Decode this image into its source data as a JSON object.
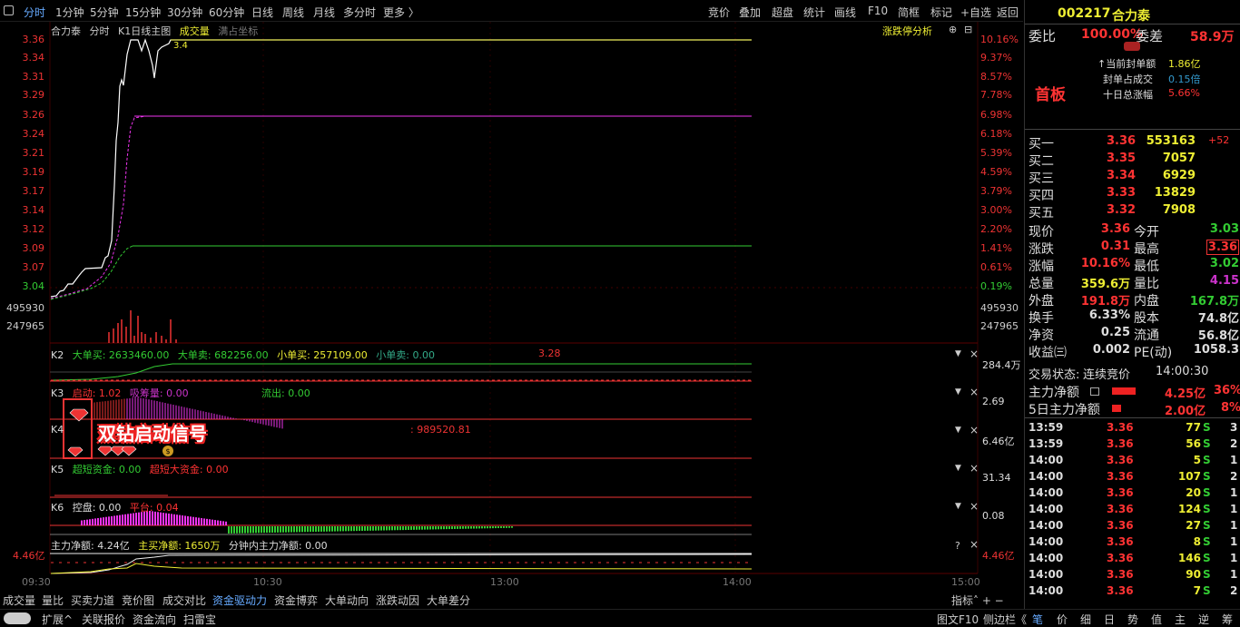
{
  "toolbar": {
    "tabs": [
      "分时",
      "1分钟",
      "5分钟",
      "15分钟",
      "30分钟",
      "60分钟",
      "日线",
      "周线",
      "月线",
      "多分时",
      "更多 〉"
    ],
    "right": [
      "竞价",
      "叠加",
      "超盘",
      "统计",
      "画线",
      "F10",
      "简框",
      "标记",
      "+自选",
      "返回"
    ]
  },
  "chart": {
    "tabs": [
      "合力泰",
      "分时",
      "K1日线主图",
      "成交量",
      "满占坐标"
    ],
    "right_btn": "涨跌停分析",
    "price_label": "3.4",
    "left_axis": [
      "3.36",
      "3.34",
      "3.31",
      "3.29",
      "3.26",
      "3.24",
      "3.21",
      "3.19",
      "3.17",
      "3.14",
      "3.12",
      "3.09",
      "3.07",
      "3.04"
    ],
    "right_axis": [
      "10.16%",
      "9.37%",
      "8.57%",
      "7.78%",
      "6.98%",
      "6.18%",
      "5.39%",
      "4.59%",
      "3.79%",
      "3.00%",
      "2.20%",
      "1.41%",
      "0.61%",
      "0.19%"
    ],
    "vol_axis": [
      "495930",
      "247965"
    ],
    "vol_axis_r": [
      "495930",
      "247965"
    ]
  },
  "k2": {
    "label": "K2",
    "items": [
      {
        "t": "大单买: 2633460.00",
        "c": "g"
      },
      {
        "t": "大单卖: 682256.00",
        "c": "g"
      },
      {
        "t": "小单买: 257109.00",
        "c": "y"
      },
      {
        "t": "小单卖: 0.00",
        "c": "c"
      }
    ],
    "extra": "3.28",
    "rv": "284.4万"
  },
  "k3": {
    "label": "K3",
    "items": [
      {
        "t": "启动: 1.02",
        "c": "r"
      },
      {
        "t": "吸筹量: 0.00",
        "c": "m"
      }
    ],
    "extra": "流出: 0.00",
    "rv": "2.69"
  },
  "k4": {
    "label": "K4",
    "extra": ": 989520.81",
    "rv": "6.46亿",
    "signal": "双钻启动信号"
  },
  "k5": {
    "label": "K5",
    "items": [
      {
        "t": "超短资金: 0.00",
        "c": "g"
      },
      {
        "t": "超短大资金: 0.00",
        "c": "r"
      }
    ],
    "rv": "31.34"
  },
  "k6": {
    "label": "K6",
    "items": [
      {
        "t": "控盘: 0.00",
        "c": "w"
      },
      {
        "t": "平台: 0.04",
        "c": "r"
      }
    ],
    "rv": "0.08"
  },
  "k7": {
    "items": [
      {
        "t": "主力净额: 4.24亿",
        "c": "w"
      },
      {
        "t": "主买净额: 1650万",
        "c": "y"
      },
      {
        "t": "分钟内主力净额: 0.00",
        "c": "w"
      }
    ],
    "lv": "4.46亿",
    "rv": "4.46亿",
    "q": "?"
  },
  "time_axis": [
    "09:30",
    "10:30",
    "13:00",
    "14:00",
    "15:00"
  ],
  "bottom_tabs": [
    "成交量",
    "量比",
    "买卖力道",
    "竞价图",
    "成交对比",
    "资金驱动力",
    "资金博弈",
    "大单动向",
    "涨跌动因",
    "大单差分"
  ],
  "bottom_right": "指标˄  +  −",
  "status_bar": [
    "扩展^",
    "关联报价",
    "资金流向",
    "扫雷宝"
  ],
  "status_right": [
    "图文F10",
    "侧边栏《",
    "笔",
    "价",
    "细",
    "日",
    "势",
    "值",
    "主",
    "逆",
    "筹"
  ],
  "quote": {
    "code": "002217",
    "name": "合力泰",
    "wb_label": "委比",
    "wb": "100.00%",
    "wc_label": "委差",
    "wc": "58.9万",
    "info": [
      {
        "l": "↑当前封单额",
        "v": "1.86亿"
      },
      {
        "l": "封单占成交",
        "v": "0.15倍"
      },
      {
        "l": "十日总涨幅",
        "v": "5.66%"
      }
    ],
    "board": "首板",
    "bids": [
      {
        "l": "买一",
        "p": "3.36",
        "v": "553163",
        "x": "+52"
      },
      {
        "l": "买二",
        "p": "3.35",
        "v": "7057",
        "x": ""
      },
      {
        "l": "买三",
        "p": "3.34",
        "v": "6929",
        "x": ""
      },
      {
        "l": "买四",
        "p": "3.33",
        "v": "13829",
        "x": ""
      },
      {
        "l": "买五",
        "p": "3.32",
        "v": "7908",
        "x": ""
      }
    ],
    "stats": [
      {
        "l1": "现价",
        "v1": "3.36",
        "c1": "r",
        "l2": "今开",
        "v2": "3.03",
        "c2": "g"
      },
      {
        "l1": "涨跌",
        "v1": "0.31",
        "c1": "r",
        "l2": "最高",
        "v2": "3.36",
        "c2": "r"
      },
      {
        "l1": "涨幅",
        "v1": "10.16%",
        "c1": "r",
        "l2": "最低",
        "v2": "3.02",
        "c2": "g"
      },
      {
        "l1": "总量",
        "v1": "359.6万",
        "c1": "y",
        "l2": "量比",
        "v2": "4.15",
        "c2": "m"
      },
      {
        "l1": "外盘",
        "v1": "191.8万",
        "c1": "r",
        "l2": "内盘",
        "v2": "167.8万",
        "c2": "g"
      },
      {
        "l1": "换手",
        "v1": "6.33%",
        "c1": "w",
        "l2": "股本",
        "v2": "74.8亿",
        "c2": "w"
      },
      {
        "l1": "净资",
        "v1": "0.25",
        "c1": "w",
        "l2": "流通",
        "v2": "56.8亿",
        "c2": "w"
      },
      {
        "l1": "收益㈢",
        "v1": "0.002",
        "c1": "w",
        "l2": "PE(动)",
        "v2": "1058.3",
        "c2": "w"
      }
    ],
    "state_label": "交易状态:",
    "state": "连续竞价",
    "state_time": "14:00:30",
    "flow": [
      {
        "l": "主力净额",
        "v": "4.25亿",
        "p": "36%"
      },
      {
        "l": "5日主力净额",
        "v": "2.00亿",
        "p": "8%"
      }
    ],
    "ticks": [
      [
        "13:59",
        "3.36",
        "77",
        "S",
        "3"
      ],
      [
        "13:59",
        "3.36",
        "56",
        "S",
        "2"
      ],
      [
        "14:00",
        "3.36",
        "5",
        "S",
        "1"
      ],
      [
        "14:00",
        "3.36",
        "107",
        "S",
        "2"
      ],
      [
        "14:00",
        "3.36",
        "20",
        "S",
        "1"
      ],
      [
        "14:00",
        "3.36",
        "124",
        "S",
        "1"
      ],
      [
        "14:00",
        "3.36",
        "27",
        "S",
        "1"
      ],
      [
        "14:00",
        "3.36",
        "8",
        "S",
        "1"
      ],
      [
        "14:00",
        "3.36",
        "146",
        "S",
        "1"
      ],
      [
        "14:00",
        "3.36",
        "90",
        "S",
        "1"
      ],
      [
        "14:00",
        "3.36",
        "7",
        "S",
        "2"
      ]
    ]
  }
}
